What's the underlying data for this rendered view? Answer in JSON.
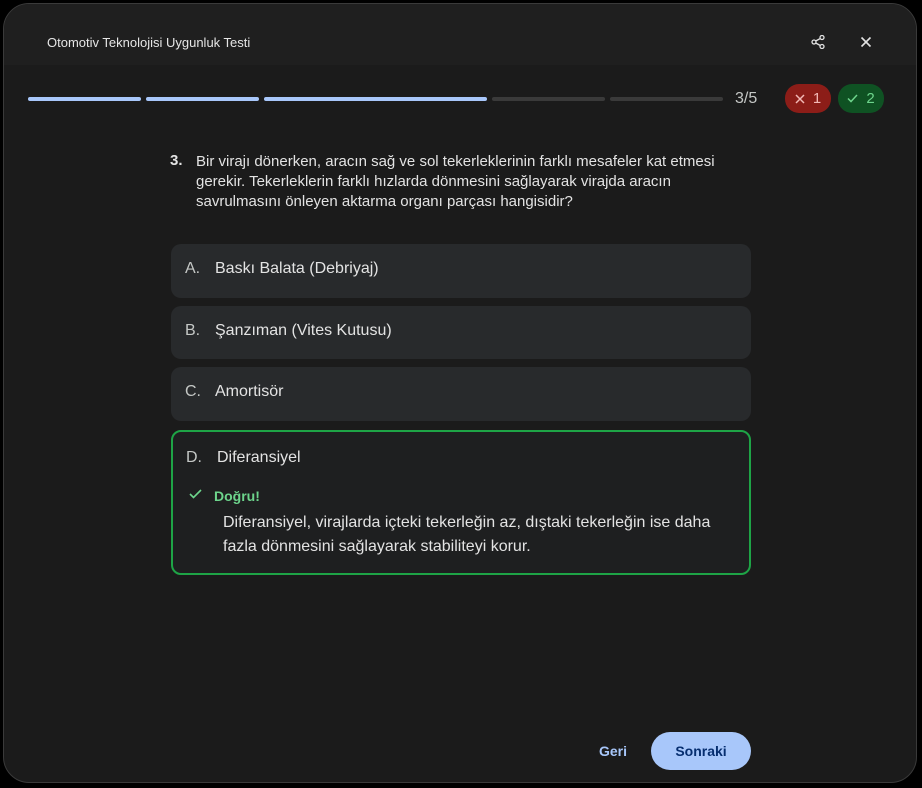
{
  "header": {
    "title": "Otomotiv Teknolojisi Uygunluk Testi",
    "share_icon": "share-icon",
    "close_icon": "close-icon"
  },
  "progress": {
    "current": 3,
    "total": 5,
    "label": "3/5",
    "wrong_count": "1",
    "right_count": "2",
    "colors": {
      "done": "#a8c7fa",
      "pending": "#3a3a3a"
    }
  },
  "question": {
    "number": "3.",
    "text": "Bir virajı dönerken, aracın sağ ve sol tekerleklerinin farklı mesafeler kat etmesi gerekir. Tekerleklerin farklı hızlarda dönmesini sağlayarak virajda aracın savrulmasını önleyen aktarma organı parçası hangisidir?"
  },
  "options": [
    {
      "letter": "A.",
      "label": "Baskı Balata (Debriyaj)"
    },
    {
      "letter": "B.",
      "label": "Şanzıman (Vites Kutusu)"
    },
    {
      "letter": "C.",
      "label": "Amortisör"
    },
    {
      "letter": "D.",
      "label": "Diferansiyel",
      "state": "correct"
    }
  ],
  "feedback": {
    "title": "Doğru!",
    "text": "Diferansiyel, virajlarda içteki tekerleğin az, dıştaki tekerleğin ise daha fazla dönmesini sağlayarak stabiliteyi korur.",
    "color": "#6dd58c"
  },
  "footer": {
    "back_label": "Geri",
    "next_label": "Sonraki"
  }
}
